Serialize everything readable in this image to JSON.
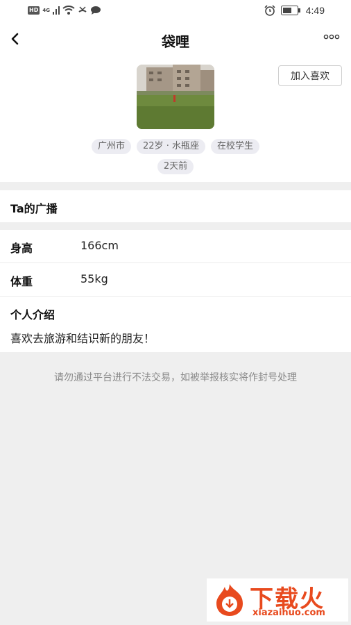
{
  "status_bar": {
    "hd": "HD",
    "network": "4G",
    "time": "4:49",
    "icons": [
      "wifi-icon",
      "signal-icon",
      "message-icon",
      "alarm-icon",
      "battery-icon"
    ]
  },
  "nav": {
    "title": "袋哩",
    "back_icon": "back-arrow-icon",
    "more_icon": "more-icon"
  },
  "profile": {
    "like_button": "加入喜欢",
    "tags": [
      "广州市",
      "22岁 · 水瓶座",
      "在校学生"
    ],
    "last_active": "2天前"
  },
  "broadcast": {
    "label": "Ta的广播"
  },
  "info": {
    "height_label": "身高",
    "height_value": "166cm",
    "weight_label": "体重",
    "weight_value": "55kg",
    "intro_label": "个人介绍",
    "intro_text": "喜欢去旅游和结识新的朋友！"
  },
  "notice": "请勿通过平台进行不法交易，如被举报核实将作封号处理",
  "watermark": {
    "brand": "下载火",
    "url": "xiazaihuo.com"
  },
  "colors": {
    "background": "#efefef",
    "tag_bg": "#ececf2",
    "watermark": "#e84a1e"
  }
}
